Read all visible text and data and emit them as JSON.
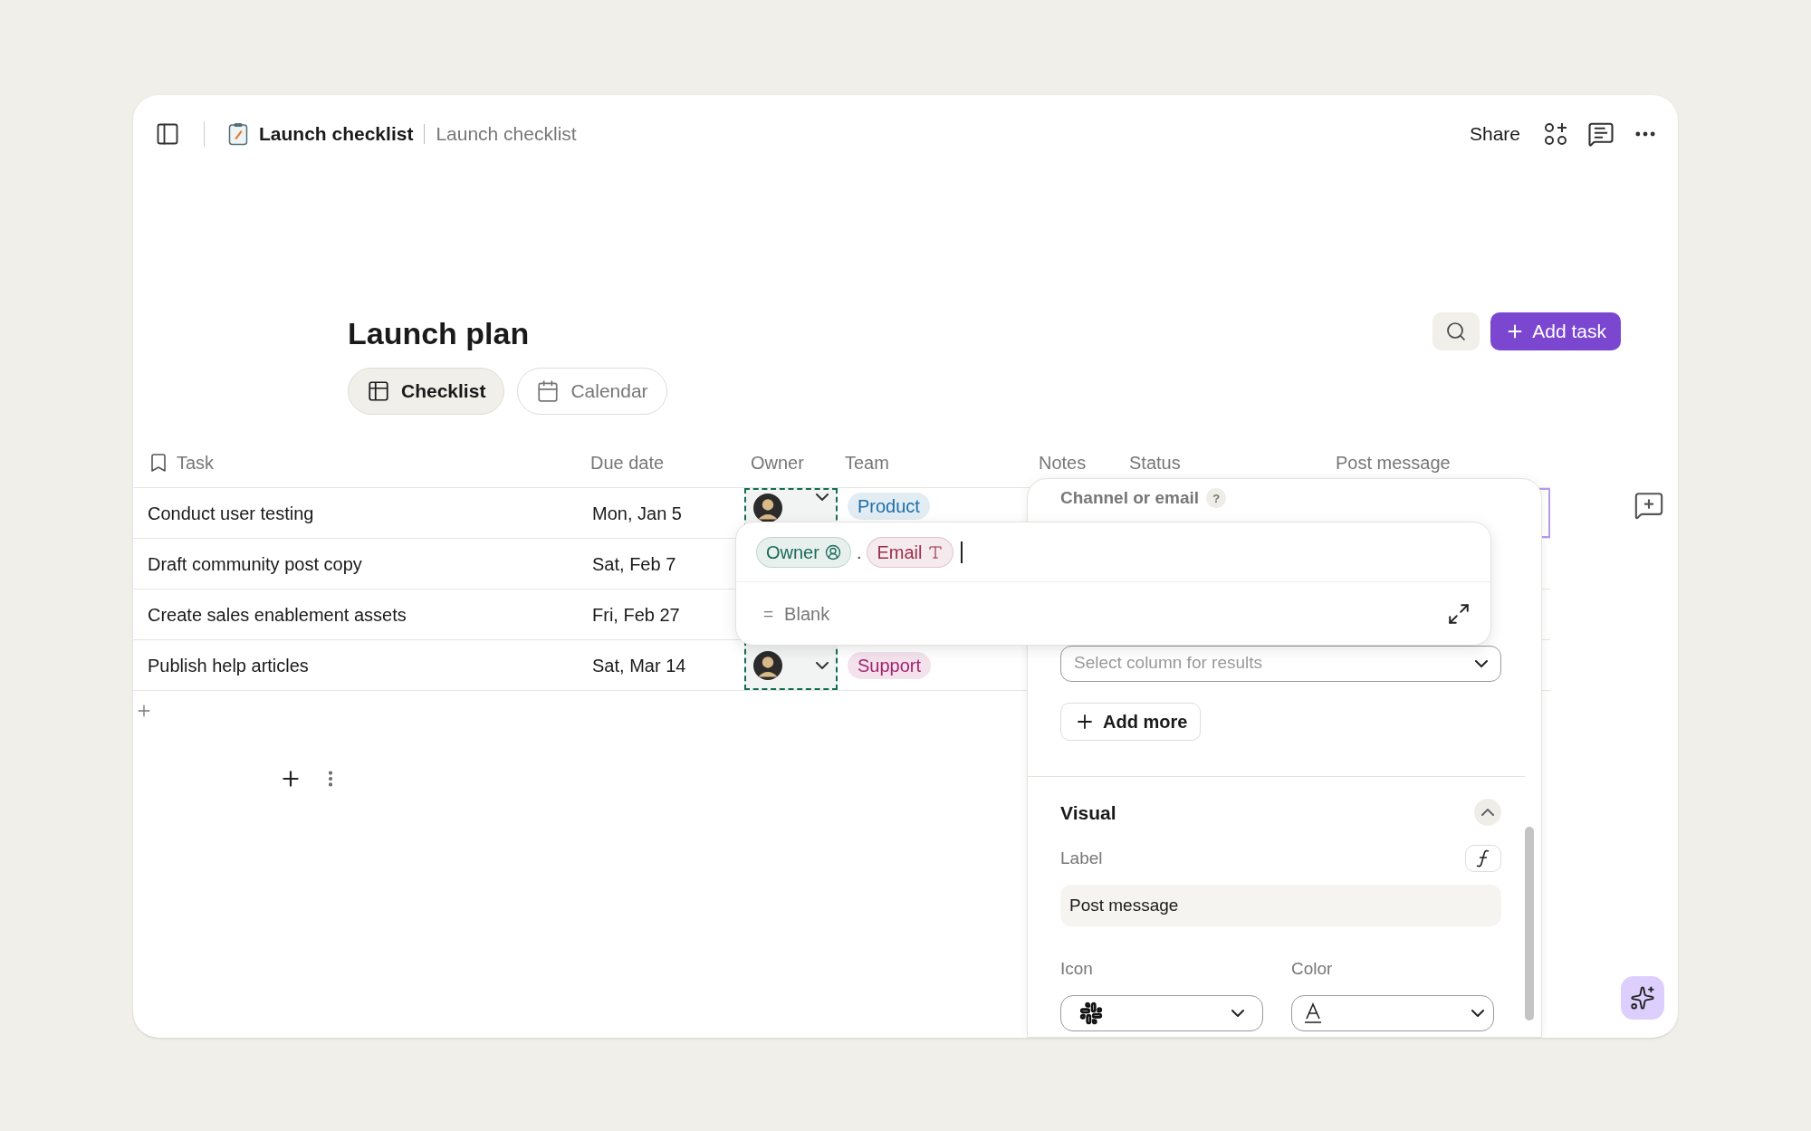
{
  "topbar": {
    "breadcrumb": [
      "Launch checklist",
      "Launch checklist"
    ],
    "share": "Share"
  },
  "page": {
    "title": "Launch plan",
    "add_task": "Add task"
  },
  "views": [
    {
      "label": "Checklist",
      "selected": true,
      "kind": "table"
    },
    {
      "label": "Calendar",
      "selected": false,
      "kind": "calendar"
    }
  ],
  "table": {
    "columns": [
      "Task",
      "Due date",
      "Owner",
      "Team",
      "Notes",
      "Status",
      "Post message"
    ],
    "rows": [
      {
        "task": "Conduct user testing",
        "due": "Mon, Jan 5",
        "owner": {
          "selected": true
        },
        "team": {
          "label": "Product",
          "color": "#1f6ea8"
        },
        "post_selected": true
      },
      {
        "task": "Draft community post copy",
        "due": "Sat, Feb 7",
        "post_selected": false
      },
      {
        "task": "Create sales enablement assets",
        "due": "Fri, Feb 27",
        "post_selected": false
      },
      {
        "task": "Publish help articles",
        "due": "Sat, Mar 14",
        "owner": {
          "selected": true
        },
        "team": {
          "label": "Support",
          "color": "#a3246e"
        },
        "post_selected": false
      }
    ]
  },
  "formula": {
    "tokens": [
      {
        "kind": "column",
        "label": "Owner",
        "color": "#1b6b58"
      },
      {
        "kind": "separator",
        "label": "."
      },
      {
        "kind": "field",
        "label": "Email",
        "color": "#9b2f4c"
      }
    ],
    "result": {
      "symbol": "=",
      "value": "Blank"
    }
  },
  "panel": {
    "channel_label": "Channel or email",
    "help": "?",
    "results_placeholder": "Select column for results",
    "add_more": "Add more",
    "visual": {
      "title": "Visual",
      "expanded": true,
      "label_caption": "Label",
      "label_value": "Post message",
      "icon_caption": "Icon",
      "color_caption": "Color"
    }
  }
}
